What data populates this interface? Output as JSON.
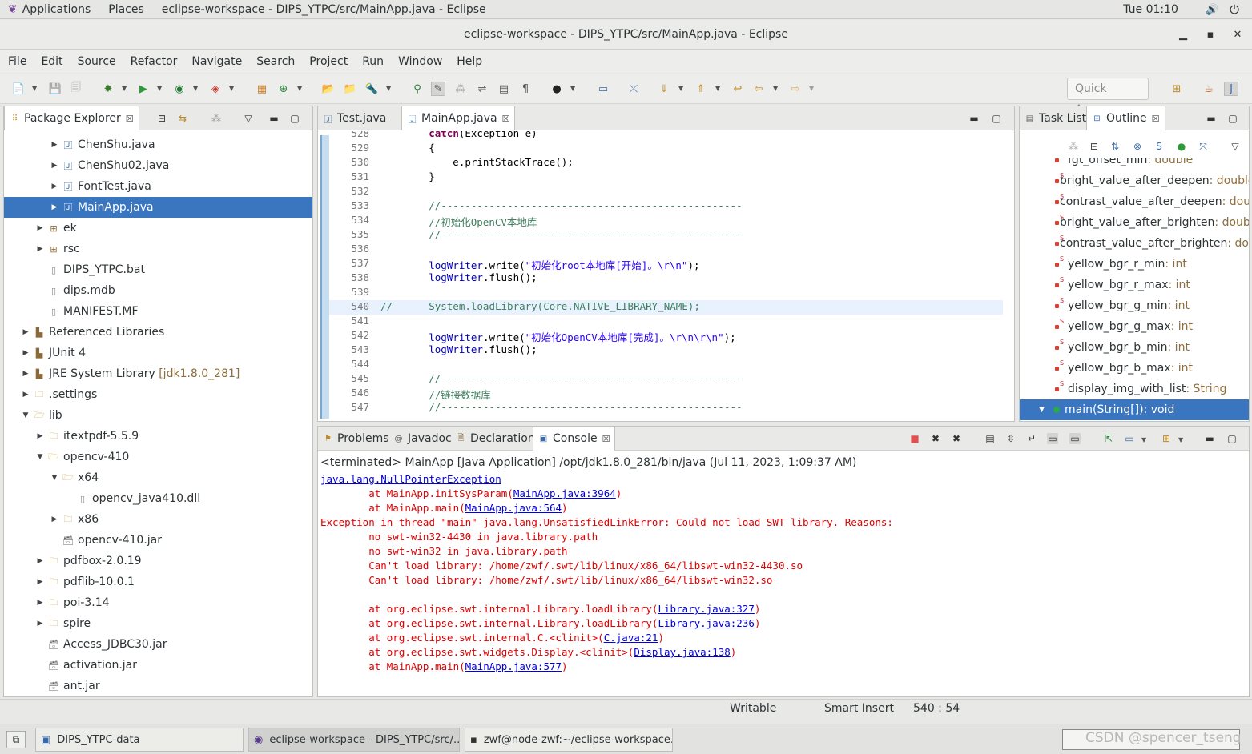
{
  "topbar": {
    "applications": "Applications",
    "places": "Places",
    "window_title": "eclipse-workspace - DIPS_YTPC/src/MainApp.java - Eclipse",
    "clock": "Tue 01:10"
  },
  "titlebar": {
    "title": "eclipse-workspace - DIPS_YTPC/src/MainApp.java - Eclipse"
  },
  "menu": [
    "File",
    "Edit",
    "Source",
    "Refactor",
    "Navigate",
    "Search",
    "Project",
    "Run",
    "Window",
    "Help"
  ],
  "quick_access": {
    "placeholder": "Quick Access"
  },
  "package_explorer": {
    "tab": "Package Explorer",
    "items": [
      {
        "label": "ChenShu.java"
      },
      {
        "label": "ChenShu02.java"
      },
      {
        "label": "FontTest.java"
      },
      {
        "label": "MainApp.java"
      },
      {
        "label": "ek"
      },
      {
        "label": "rsc"
      },
      {
        "label": "DIPS_YTPC.bat"
      },
      {
        "label": "dips.mdb"
      },
      {
        "label": "MANIFEST.MF"
      },
      {
        "label": "Referenced Libraries"
      },
      {
        "label": "JUnit 4"
      },
      {
        "label": "JRE System Library",
        "decoration": "[jdk1.8.0_281]"
      },
      {
        "label": ".settings"
      },
      {
        "label": "lib"
      },
      {
        "label": "itextpdf-5.5.9"
      },
      {
        "label": "opencv-410"
      },
      {
        "label": "x64"
      },
      {
        "label": "opencv_java410.dll"
      },
      {
        "label": "x86"
      },
      {
        "label": "opencv-410.jar"
      },
      {
        "label": "pdfbox-2.0.19"
      },
      {
        "label": "pdflib-10.0.1"
      },
      {
        "label": "poi-3.14"
      },
      {
        "label": "spire"
      },
      {
        "label": "Access_JDBC30.jar"
      },
      {
        "label": "activation.jar"
      },
      {
        "label": "ant.jar"
      }
    ]
  },
  "editor": {
    "tabs": [
      "Test.java",
      "MainApp.java"
    ],
    "lines": [
      {
        "n": "528",
        "parts": [
          {
            "t": "        "
          },
          {
            "t": "catch",
            "c": "kw"
          },
          {
            "t": "(Exception e)"
          }
        ]
      },
      {
        "n": "529",
        "parts": [
          {
            "t": "        {"
          }
        ]
      },
      {
        "n": "530",
        "parts": [
          {
            "t": "            e.printStackTrace();"
          }
        ]
      },
      {
        "n": "531",
        "parts": [
          {
            "t": "        }"
          }
        ]
      },
      {
        "n": "532",
        "parts": [
          {
            "t": ""
          }
        ]
      },
      {
        "n": "533",
        "parts": [
          {
            "t": "        //--------------------------------------------------",
            "c": "cm"
          }
        ]
      },
      {
        "n": "534",
        "parts": [
          {
            "t": "        //初始化OpenCV本地库",
            "c": "cm"
          }
        ]
      },
      {
        "n": "535",
        "parts": [
          {
            "t": "        //--------------------------------------------------",
            "c": "cm"
          }
        ]
      },
      {
        "n": "536",
        "parts": [
          {
            "t": ""
          }
        ]
      },
      {
        "n": "537",
        "parts": [
          {
            "t": "        "
          },
          {
            "t": "logWriter",
            "c": "fld"
          },
          {
            "t": ".write("
          },
          {
            "t": "\"初始化root本地库[开始]。\\r\\n\"",
            "c": "st"
          },
          {
            "t": ");"
          }
        ]
      },
      {
        "n": "538",
        "parts": [
          {
            "t": "        "
          },
          {
            "t": "logWriter",
            "c": "fld"
          },
          {
            "t": ".flush();"
          }
        ]
      },
      {
        "n": "539",
        "parts": [
          {
            "t": ""
          }
        ]
      },
      {
        "n": "540",
        "parts": [
          {
            "t": "//      System.loadLibrary(Core.NATIVE_LIBRARY_NAME);",
            "c": "cm"
          }
        ]
      },
      {
        "n": "541",
        "parts": [
          {
            "t": ""
          }
        ]
      },
      {
        "n": "542",
        "parts": [
          {
            "t": "        "
          },
          {
            "t": "logWriter",
            "c": "fld"
          },
          {
            "t": ".write("
          },
          {
            "t": "\"初始化OpenCV本地库[完成]。\\r\\n\\r\\n\"",
            "c": "st"
          },
          {
            "t": ");"
          }
        ]
      },
      {
        "n": "543",
        "parts": [
          {
            "t": "        "
          },
          {
            "t": "logWriter",
            "c": "fld"
          },
          {
            "t": ".flush();"
          }
        ]
      },
      {
        "n": "544",
        "parts": [
          {
            "t": ""
          }
        ]
      },
      {
        "n": "545",
        "parts": [
          {
            "t": "        //--------------------------------------------------",
            "c": "cm"
          }
        ]
      },
      {
        "n": "546",
        "parts": [
          {
            "t": "        //链接数据库",
            "c": "cm"
          }
        ]
      },
      {
        "n": "547",
        "parts": [
          {
            "t": "        //--------------------------------------------------",
            "c": "cm"
          }
        ]
      }
    ]
  },
  "console": {
    "tabs": [
      "Problems",
      "Javadoc",
      "Declaration",
      "Console"
    ],
    "header": "<terminated> MainApp [Java Application] /opt/jdk1.8.0_281/bin/java (Jul 11, 2023, 1:09:37 AM)",
    "lines": [
      [
        {
          "t": "java.lang.NullPointerException",
          "link": true
        }
      ],
      [
        {
          "t": "        at MainApp.initSysParam("
        },
        {
          "t": "MainApp.java:3964",
          "link": true
        },
        {
          "t": ")"
        }
      ],
      [
        {
          "t": "        at MainApp.main("
        },
        {
          "t": "MainApp.java:564",
          "link": true
        },
        {
          "t": ")"
        }
      ],
      [
        {
          "t": "Exception in thread \"main\" java.lang.UnsatisfiedLinkError: Could not load SWT library. Reasons: "
        }
      ],
      [
        {
          "t": "        no swt-win32-4430 in java.library.path"
        }
      ],
      [
        {
          "t": "        no swt-win32 in java.library.path"
        }
      ],
      [
        {
          "t": "        Can't load library: /home/zwf/.swt/lib/linux/x86_64/libswt-win32-4430.so"
        }
      ],
      [
        {
          "t": "        Can't load library: /home/zwf/.swt/lib/linux/x86_64/libswt-win32.so"
        }
      ],
      [
        {
          "t": ""
        }
      ],
      [
        {
          "t": "        at org.eclipse.swt.internal.Library.loadLibrary("
        },
        {
          "t": "Library.java:327",
          "link": true
        },
        {
          "t": ")"
        }
      ],
      [
        {
          "t": "        at org.eclipse.swt.internal.Library.loadLibrary("
        },
        {
          "t": "Library.java:236",
          "link": true
        },
        {
          "t": ")"
        }
      ],
      [
        {
          "t": "        at org.eclipse.swt.internal.C.<clinit>("
        },
        {
          "t": "C.java:21",
          "link": true
        },
        {
          "t": ")"
        }
      ],
      [
        {
          "t": "        at org.eclipse.swt.widgets.Display.<clinit>("
        },
        {
          "t": "Display.java:138",
          "link": true
        },
        {
          "t": ")"
        }
      ],
      [
        {
          "t": "        at MainApp.main("
        },
        {
          "t": "MainApp.java:577",
          "link": true
        },
        {
          "t": ")"
        }
      ]
    ]
  },
  "outline": {
    "tabs": [
      "Task List",
      "Outline"
    ],
    "items": [
      {
        "name": "fgt_offset_min",
        "type": " : double"
      },
      {
        "name": "bright_value_after_deepen",
        "type": " : double"
      },
      {
        "name": "contrast_value_after_deepen",
        "type": " : double"
      },
      {
        "name": "bright_value_after_brighten",
        "type": " : double"
      },
      {
        "name": "contrast_value_after_brighten",
        "type": " : double"
      },
      {
        "name": "yellow_bgr_r_min",
        "type": " : int"
      },
      {
        "name": "yellow_bgr_r_max",
        "type": " : int"
      },
      {
        "name": "yellow_bgr_g_min",
        "type": " : int"
      },
      {
        "name": "yellow_bgr_g_max",
        "type": " : int"
      },
      {
        "name": "yellow_bgr_b_min",
        "type": " : int"
      },
      {
        "name": "yellow_bgr_b_max",
        "type": " : int"
      },
      {
        "name": "display_img_with_list",
        "type": " : String"
      },
      {
        "name": "main(String[])",
        "type": " : void"
      }
    ]
  },
  "status": {
    "writable": "Writable",
    "insert_mode": "Smart Insert",
    "position": "540 : 54"
  },
  "taskbar": {
    "items": [
      "DIPS_YTPC-data",
      "eclipse-workspace - DIPS_YTPC/src/...",
      "zwf@node-zwf:~/eclipse-workspace..."
    ],
    "watermark": "CSDN @spencer_tseng"
  }
}
